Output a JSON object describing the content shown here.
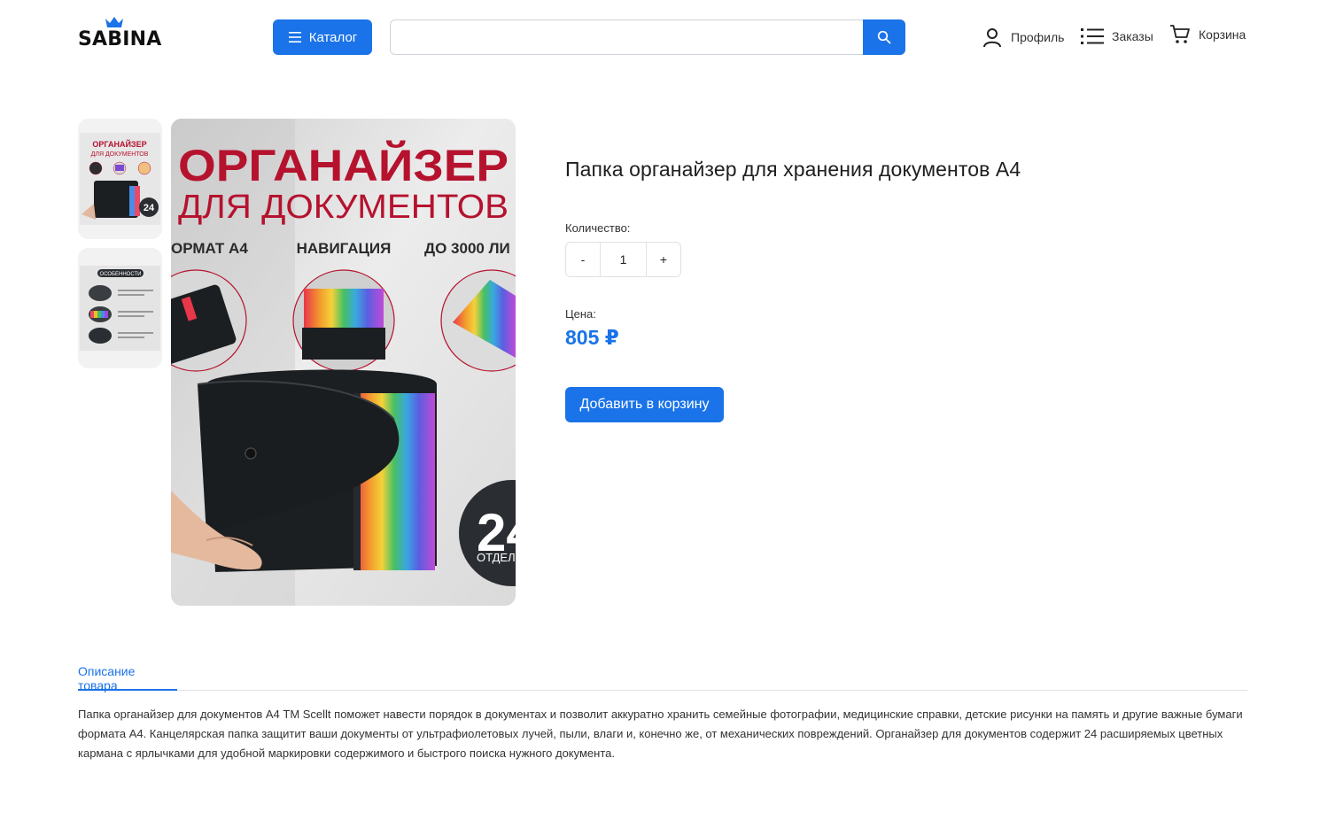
{
  "header": {
    "logo_text": "SABINA",
    "catalog_label": "Каталог",
    "search": {
      "value": "",
      "placeholder": ""
    },
    "nav": {
      "profile": "Профиль",
      "orders": "Заказы",
      "cart": "Корзина"
    }
  },
  "gallery": {
    "main_image": {
      "headline_1": "ОРГАНАЙЗЕР",
      "headline_2": "ДЛЯ ДОКУМЕНТОВ",
      "features": [
        "ОРМАТ А4",
        "НАВИГАЦИЯ",
        "ДО 3000 ЛИ"
      ],
      "badge_number": "24",
      "badge_text": "ОТДЕЛ"
    },
    "thumbnails": [
      {
        "title_1": "ОРГАНАЙЗЕР",
        "title_2": "ДЛЯ ДОКУМЕНТОВ",
        "badge": "24"
      },
      {
        "title": "ОСОБЕННОСТИ"
      }
    ]
  },
  "product": {
    "title": "Папка органайзер для хранения документов А4",
    "quantity_label": "Количество:",
    "minus_label": "-",
    "plus_label": "+",
    "quantity_value": "1",
    "price_label": "Цена:",
    "price": "805 ₽",
    "add_to_cart_label": "Добавить в корзину"
  },
  "tabs": {
    "active_label": "Описание товара"
  },
  "description": "Папка органайзер для документов А4 ТМ Scellt поможет навести порядок в документах и позволит аккуратно хранить семейные фотографии, медицинские справки, детские рисунки на память и другие важные бумаги формата А4. Канцелярская папка защитит ваши документы от ультрафиолетовых лучей, пыли, влаги и, конечно же, от механических повреждений. Органайзер для документов содержит 24 расширяемых цветных кармана с ярлычками для удобной маркировки содержимого и быстрого поиска нужного документа.",
  "colors": {
    "accent": "#1a73e8",
    "headline_red": "#b5122e",
    "folder_black": "#1c1f22"
  }
}
